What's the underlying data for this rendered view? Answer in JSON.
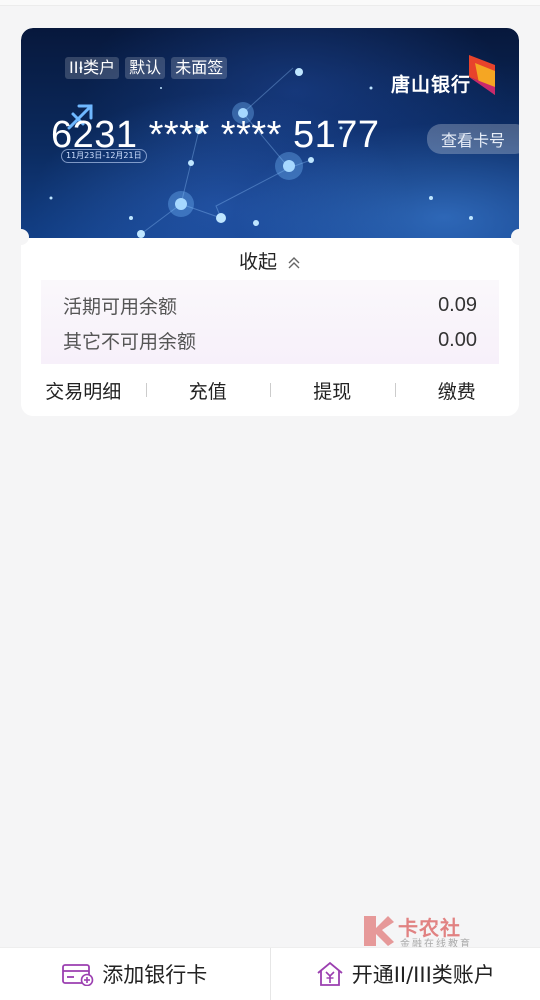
{
  "card": {
    "tags": [
      "III类户",
      "默认",
      "未面签"
    ],
    "bank_name": "唐山银行",
    "zodiac_date": "11月23日-12月21日",
    "number": "6231 **** **** 5177",
    "view_number_label": "查看卡号"
  },
  "collapse_label": "收起",
  "balances": [
    {
      "label": "活期可用余额",
      "value": "0.09"
    },
    {
      "label": "其它不可用余额",
      "value": "0.00"
    }
  ],
  "actions": [
    "交易明细",
    "充值",
    "提现",
    "缴费"
  ],
  "watermark": {
    "title": "卡农社区",
    "subtitle": "金融在线教育"
  },
  "bottom": {
    "add_card_label": "添加银行卡",
    "open_account_label": "开通II/III类账户"
  },
  "colors": {
    "accent": "#9b3fb0",
    "bank_logo_red": "#e8432b",
    "bank_logo_yellow": "#f5a623"
  }
}
